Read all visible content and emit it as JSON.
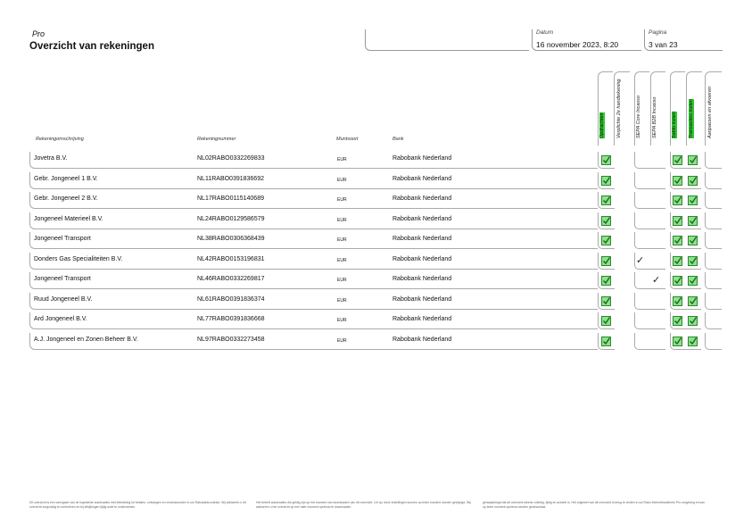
{
  "header": {
    "brand": "Pro",
    "title": "Overzicht van rekeningen",
    "datum_label": "Datum",
    "datum_value": "16 november 2023, 8:20",
    "pagina_label": "Pagina",
    "pagina_value": "3 van 23"
  },
  "columns": {
    "omschrijving": "Rekeningomschrijving",
    "nummer": "Rekeningnummer",
    "muntsoort": "Muntsoort",
    "bank": "Bank"
  },
  "vertical_headers": [
    {
      "label": "Opdrachten",
      "highlight": true
    },
    {
      "label": "Verplichte 2e handtekening",
      "highlight": false
    },
    {
      "label": "SEPA Core Incasso",
      "highlight": false
    },
    {
      "label": "SEPA B2B Incasso",
      "highlight": false
    },
    {
      "label": "Saldo inzien",
      "highlight": true
    },
    {
      "label": "Transacties inzien",
      "highlight": true
    },
    {
      "label": "Aanpassen en afvoeren",
      "highlight": false
    }
  ],
  "rows": [
    {
      "omschrijving": "Jovetra B.V.",
      "nummer": "NL02RABO0332269833",
      "muntsoort": "EUR",
      "bank": "Rabobank Nederland",
      "core": false,
      "b2b": false
    },
    {
      "omschrijving": "Gebr. Jongeneel 1 B.V.",
      "nummer": "NL11RABO0391836692",
      "muntsoort": "EUR",
      "bank": "Rabobank Nederland",
      "core": false,
      "b2b": false
    },
    {
      "omschrijving": "Gebr. Jongeneel 2 B.V.",
      "nummer": "NL17RABO0115140689",
      "muntsoort": "EUR",
      "bank": "Rabobank Nederland",
      "core": false,
      "b2b": false
    },
    {
      "omschrijving": "Jongeneel Materieel B.V.",
      "nummer": "NL24RABO0129586579",
      "muntsoort": "EUR",
      "bank": "Rabobank Nederland",
      "core": false,
      "b2b": false
    },
    {
      "omschrijving": "Jongeneel Transport",
      "nummer": "NL38RABO0306368439",
      "muntsoort": "EUR",
      "bank": "Rabobank Nederland",
      "core": false,
      "b2b": false
    },
    {
      "omschrijving": "Donders Gas Specialiteiten B.V.",
      "nummer": "NL42RABO0153196831",
      "muntsoort": "EUR",
      "bank": "Rabobank Nederland",
      "core": true,
      "b2b": false
    },
    {
      "omschrijving": "Jongeneel Transport",
      "nummer": "NL46RABO0332269817",
      "muntsoort": "EUR",
      "bank": "Rabobank Nederland",
      "core": false,
      "b2b": true
    },
    {
      "omschrijving": "Ruud Jongeneel B.V.",
      "nummer": "NL61RABO0391836374",
      "muntsoort": "EUR",
      "bank": "Rabobank Nederland",
      "core": false,
      "b2b": false
    },
    {
      "omschrijving": "Ard Jongeneel B.V.",
      "nummer": "NL77RABO0391836668",
      "muntsoort": "EUR",
      "bank": "Rabobank Nederland",
      "core": false,
      "b2b": false
    },
    {
      "omschrijving": "A.J. Jongeneel en Zonen Beheer B.V.",
      "nummer": "NL97RABO0332273458",
      "muntsoort": "EUR",
      "bank": "Rabobank Nederland",
      "core": false,
      "b2b": false
    }
  ],
  "footer": [
    "Dit overzicht is een weergave van de ingestelde autorisaties met betrekking tot betalen, ontvangen en verantwoorden in uw Rabobankcontract. Wij adviseren u dit overzicht zorgvuldig te controleren en bij afwijkingen tijdig actie te ondernemen.",
    "Het betreft autorisaties die geldig zijn op het moment van downloaden van dit overzicht. Let op: deze instellingen kunnen op ieder moment worden gewijzigd. Wij adviseren u het overzicht op een later moment opnieuw te downloaden.",
    "geraadpleegd dat dit overzicht steeds volledig, tijdig en actueel is. Het origineel van dit overzicht is terug te vinden in uw Rabo Internetbankieren Pro omgeving en kan op ieder moment opnieuw worden gedownload."
  ]
}
